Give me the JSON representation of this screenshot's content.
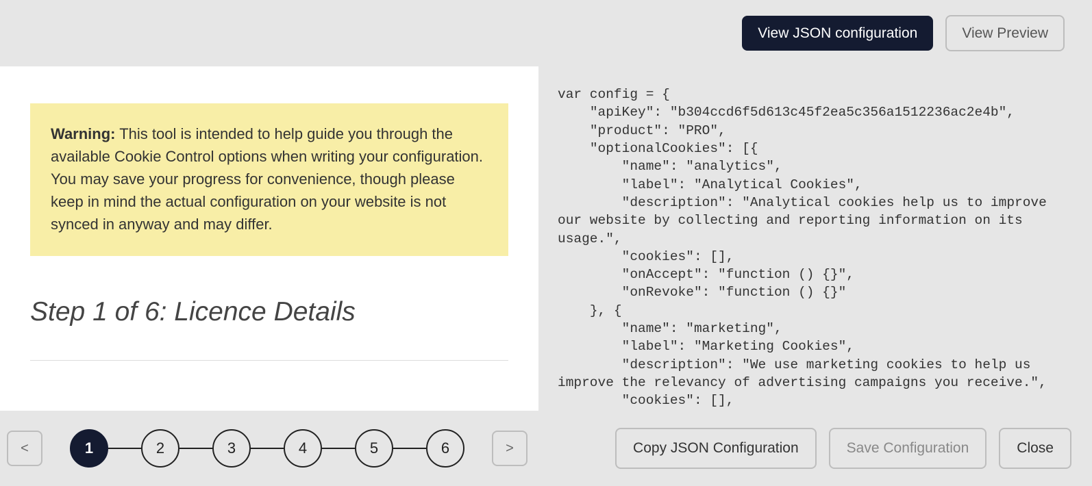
{
  "header": {
    "view_json_label": "View JSON configuration",
    "view_preview_label": "View Preview"
  },
  "warning": {
    "prefix": "Warning:",
    "text": " This tool is intended to help guide you through the available Cookie Control options when writing your configuration. You may save your progress for convenience, though please keep in mind the actual configuration on your website is not synced in anyway and may differ."
  },
  "step": {
    "title": "Step 1 of 6: Licence Details"
  },
  "code_text": "var config = {\n    \"apiKey\": \"b304ccd6f5d613c45f2ea5c356a1512236ac2e4b\",\n    \"product\": \"PRO\",\n    \"optionalCookies\": [{\n        \"name\": \"analytics\",\n        \"label\": \"Analytical Cookies\",\n        \"description\": \"Analytical cookies help us to improve our website by collecting and reporting information on its usage.\",\n        \"cookies\": [],\n        \"onAccept\": \"function () {}\",\n        \"onRevoke\": \"function () {}\"\n    }, {\n        \"name\": \"marketing\",\n        \"label\": \"Marketing Cookies\",\n        \"description\": \"We use marketing cookies to help us improve the relevancy of advertising campaigns you receive.\",\n        \"cookies\": [],\n        \"onAccept\": \"function () {}\",",
  "nav": {
    "prev_label": "<",
    "next_label": ">",
    "steps": [
      "1",
      "2",
      "3",
      "4",
      "5",
      "6"
    ],
    "active_step": 1
  },
  "footer": {
    "copy_label": "Copy JSON Configuration",
    "save_label": "Save Configuration",
    "close_label": "Close"
  }
}
